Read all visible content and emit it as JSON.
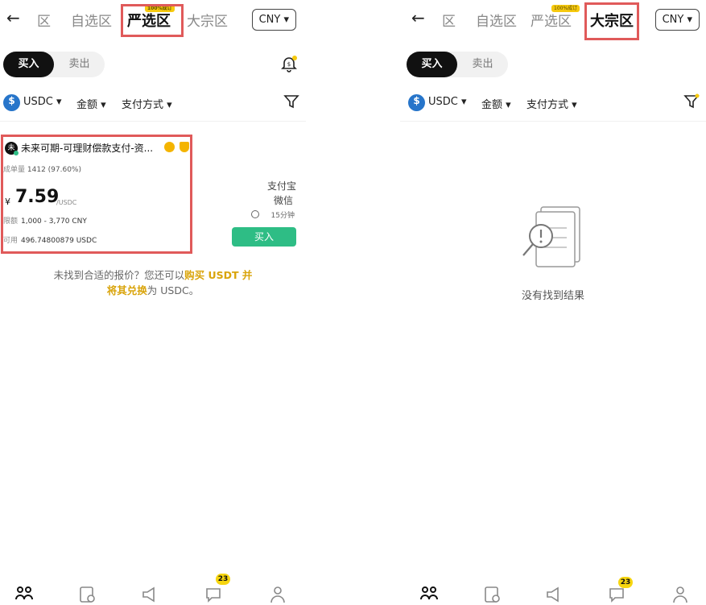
{
  "left": {
    "header": {
      "back": "←",
      "tabs": [
        "区",
        "自选区",
        "严选区",
        "大宗区"
      ],
      "active_badge": "100%成订",
      "currency": "CNY ▾"
    },
    "toggle": {
      "buy": "买入",
      "sell": "卖出"
    },
    "filters": {
      "coin": "USDC ▾",
      "amount": "金额 ▾",
      "payment": "支付方式 ▾"
    },
    "card": {
      "avatar": "未",
      "merchant": "未来可期-可理财偿款支付-资...",
      "stats_label": "成单量",
      "stats_value": "1412 (97.60%)",
      "price_symbol": "¥",
      "price": "7.59",
      "price_unit": "/USDC",
      "limit_label": "限额",
      "limit_value": "1,000 - 3,770 CNY",
      "avail_label": "可用",
      "avail_value": "496.74800879 USDC"
    },
    "payments": [
      "支付宝",
      "微信"
    ],
    "time": "15分钟",
    "buy_button": "买入",
    "notfound": {
      "pre": "未找到合适的报价？您还可以",
      "link1": "购买 USDT 并",
      "link2": "将其兑换",
      "post": "为 USDC。"
    }
  },
  "right": {
    "header": {
      "back": "←",
      "tabs": [
        "区",
        "自选区",
        "严选区",
        "大宗区"
      ],
      "badge": "100%成订",
      "currency": "CNY ▾"
    },
    "toggle": {
      "buy": "买入",
      "sell": "卖出"
    },
    "filters": {
      "coin": "USDC ▾",
      "amount": "金额 ▾",
      "payment": "支付方式 ▾"
    },
    "empty": "没有找到结果"
  },
  "bottom_nav": {
    "chat_badge": "23",
    "icons": [
      "p2p-icon",
      "orders-icon",
      "announcement-icon",
      "chat-icon",
      "profile-icon"
    ]
  },
  "colors": {
    "accent": "#2ebd85",
    "highlight": "#e05a5a",
    "link": "#d9a40b",
    "usdc": "#2775ca"
  }
}
